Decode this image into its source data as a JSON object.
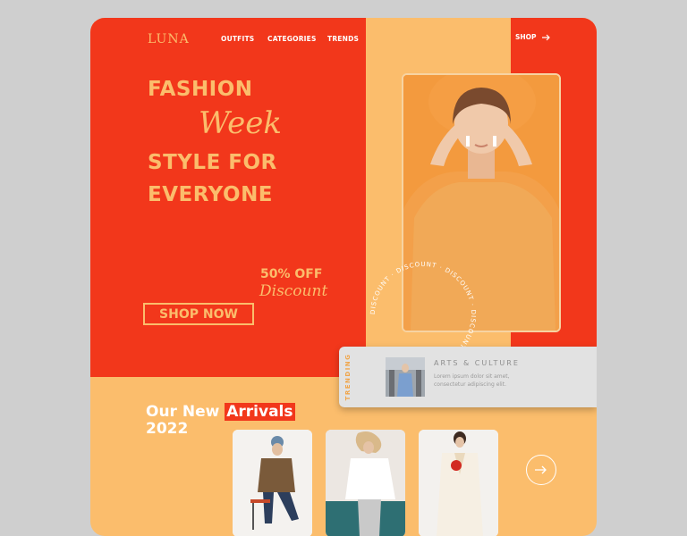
{
  "brand": {
    "logo": "LUNA"
  },
  "nav": {
    "outfits": "OUTFITS",
    "categories": "CATEGORIES",
    "trends": "TRENDS",
    "shop": "SHOP"
  },
  "hero": {
    "line1": "FASHION",
    "script": "Week",
    "line2": "STYLE FOR",
    "line3": "EVERYONE",
    "offer": "50% OFF",
    "offer_script": "Discount",
    "cta": "SHOP NOW",
    "ring_text": "DISCOUNT · DISCOUNT · DISCOUNT · DISCOUNT · "
  },
  "trending": {
    "label": "TRENDING",
    "title": "ARTS & CULTURE",
    "description": "Lorem ipsum dolor sit amet, consectetur adipiscing elit."
  },
  "arrivals": {
    "prefix": "Our New ",
    "highlight": "Arrivals",
    "year": "2022"
  },
  "colors": {
    "red": "#f2371b",
    "peach": "#fbbd6c",
    "white": "#ffffff"
  },
  "icons": {
    "arrow": "arrow-right-icon"
  }
}
